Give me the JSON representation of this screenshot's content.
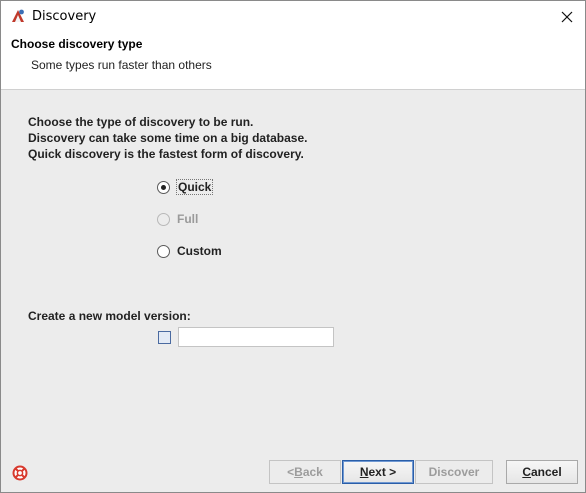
{
  "window": {
    "title": "Discovery",
    "close_symbol": "✕",
    "icons": {
      "app": "discovery-app-icon",
      "close": "close-icon",
      "help": "help-lifebuoy-icon"
    }
  },
  "header": {
    "title": "Choose discovery type",
    "subtitle": "Some types run faster than others"
  },
  "main": {
    "description": [
      "Choose the type of discovery to be run.",
      "Discovery can take some time on a big database.",
      "Quick discovery is the fastest form of discovery."
    ],
    "options": [
      {
        "label": "Quick",
        "selected": true,
        "enabled": true,
        "focused": true
      },
      {
        "label": "Full",
        "selected": false,
        "enabled": false,
        "focused": false
      },
      {
        "label": "Custom",
        "selected": false,
        "enabled": true,
        "focused": false
      }
    ],
    "model_version": {
      "label": "Create a new model version:",
      "checked": false,
      "value": ""
    }
  },
  "footer": {
    "buttons": {
      "back": {
        "mnemonic_prefix": "< ",
        "mnemonic": "B",
        "rest": "ack",
        "enabled": false
      },
      "next": {
        "mnemonic_prefix": "",
        "mnemonic": "N",
        "rest": "ext >",
        "enabled": true
      },
      "discover": {
        "label": "Discover",
        "enabled": false
      },
      "cancel": {
        "mnemonic_prefix": "",
        "mnemonic": "C",
        "rest": "ancel",
        "enabled": true
      }
    }
  },
  "colors": {
    "background": "#ececec",
    "header_bg": "#ffffff",
    "default_button_border": "#2a5ea8",
    "help_icon": "#d83a2e"
  }
}
